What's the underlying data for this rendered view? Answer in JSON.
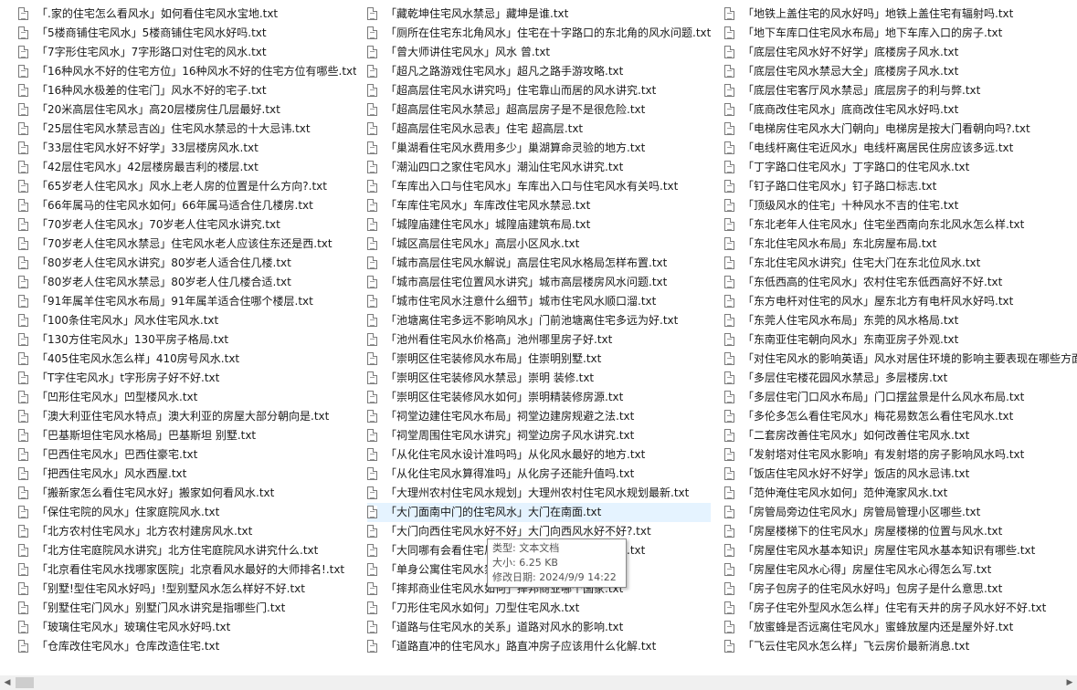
{
  "columns": [
    [
      "「.家的住宅怎么看风水」如何看住宅风水宝地.txt",
      "「5楼商铺住宅风水」5楼商铺住宅风水好吗.txt",
      "「7字形住宅风水」7字形路口对住宅的风水.txt",
      "「16种风水不好的住宅方位」16种风水不好的住宅方位有哪些.txt",
      "「16种风水极差的住宅门」风水不好的宅子.txt",
      "「20米高层住宅风水」高20层楼房住几层最好.txt",
      "「25层住宅风水禁忌吉凶」住宅风水禁忌的十大忌讳.txt",
      "「33层住宅风水好不好学」33层楼房风水.txt",
      "「42层住宅风水」42层楼房最吉利的楼层.txt",
      "「65岁老人住宅风水」风水上老人房的位置是什么方向?.txt",
      "「66年属马的住宅风水如何」66年属马适合住几楼房.txt",
      "「70岁老人住宅风水」70岁老人住宅风水讲究.txt",
      "「70岁老人住宅风水禁忌」住宅风水老人应该住东还是西.txt",
      "「80岁老人住宅风水讲究」80岁老人适合住几楼.txt",
      "「80岁老人住宅风水禁忌」80岁老人住几楼合适.txt",
      "「91年属羊住宅风水布局」91年属羊适合住哪个楼层.txt",
      "「100条住宅风水」风水住宅风水.txt",
      "「130方住宅风水」130平房子格局.txt",
      "「405住宅风水怎么样」410房号风水.txt",
      "「T字住宅风水」t字形房子好不好.txt",
      "「凹形住宅风水」凹型楼风水.txt",
      "「澳大利亚住宅风水特点」澳大利亚的房屋大部分朝向是.txt",
      "「巴基斯坦住宅风水格局」巴基斯坦 别墅.txt",
      "「巴西住宅风水」巴西住豪宅.txt",
      "「把西住宅风水」风水西屋.txt",
      "「搬新家怎么看住宅风水好」搬家如何看风水.txt",
      "「保住宅院的风水」住家庭院风水.txt",
      "「北方农村住宅风水」北方农村建房风水.txt",
      "「北方住宅庭院风水讲究」北方住宅庭院风水讲究什么.txt",
      "「北京看住宅风水找哪家医院」北京看风水最好的大师排名!.txt",
      "「别墅!型住宅风水好吗」!型别墅风水怎么样好不好.txt",
      "「别墅住宅门风水」别墅门风水讲究是指哪些门.txt",
      "「玻璃住宅风水」玻璃住宅风水好吗.txt",
      "「仓库改住宅风水」仓库改造住宅.txt"
    ],
    [
      "「藏乾坤住宅风水禁忌」藏坤是谁.txt",
      "「厕所在住宅东北角风水」住宅在十字路口的东北角的风水问题.txt",
      "「曾大师讲住宅风水」风水 曾.txt",
      "「超凡之路游戏住宅风水」超凡之路手游攻略.txt",
      "「超高层住宅风水讲究吗」住宅靠山而居的风水讲究.txt",
      "「超高层住宅风水禁忌」超高层房子是不是很危险.txt",
      "「超高层住宅风水忌表」住宅 超高层.txt",
      "「巢湖看住宅风水费用多少」巢湖算命灵验的地方.txt",
      "「潮汕四口之家住宅风水」潮汕住宅风水讲究.txt",
      "「车库出入口与住宅风水」车库出入口与住宅风水有关吗.txt",
      "「车库住宅风水」车库改住宅风水禁忌.txt",
      "「城隍庙建住宅风水」城隍庙建筑布局.txt",
      "「城区高层住宅风水」高层小区风水.txt",
      "「城市高层住宅风水解说」高层住宅风水格局怎样布置.txt",
      "「城市高层住宅位置风水讲究」城市高层楼房风水问题.txt",
      "「城市住宅风水注意什么细节」城市住宅风水顺口溜.txt",
      "「池塘离住宅多远不影响风水」门前池塘离住宅多远为好.txt",
      "「池州看住宅风水价格高」池州哪里房子好.txt",
      "「崇明区住宅装修风水布局」住崇明别墅.txt",
      "「崇明区住宅装修风水禁忌」崇明 装修.txt",
      "「崇明区住宅装修风水如何」崇明精装修房源.txt",
      "「祠堂边建住宅风水布局」祠堂边建房规避之法.txt",
      "「祠堂周围住宅风水讲究」祠堂边房子风水讲究.txt",
      "「从化住宅风水设计准吗吗」从化风水最好的地方.txt",
      "「从化住宅风水算得准吗」从化房子还能升值吗.txt",
      "「大理州农村住宅风水规划」大理州农村住宅风水规划最新.txt",
      "「大门面南中门的住宅风水」大门在南面.txt",
      "「大门向西住宅风水好不好」大门向西风水好不好?.txt",
      "「大同哪有会看住宅风水的人」大同会看风水的人.txt",
      "「单身公寓住宅风水禁忌大全」单身公寓风水.txt",
      "「摔邦商业住宅风水如何」摔邦商业哪个国家.txt",
      "「刀形住宅风水如何」刀型住宅风水.txt",
      "「道路与住宅风水的关系」道路对风水的影响.txt",
      "「道路直冲的住宅风水」路直冲房子应该用什么化解.txt"
    ],
    [
      "「地铁上盖住宅的风水好吗」地铁上盖住宅有辐射吗.txt",
      "「地下车库口住宅风水布局」地下车库入口的房子.txt",
      "「底层住宅风水好不好学」底楼房子风水.txt",
      "「底层住宅风水禁忌大全」底楼房子风水.txt",
      "「底层住宅客厅风水禁忌」底层房子的利与弊.txt",
      "「底商改住宅风水」底商改住宅风水好吗.txt",
      "「电梯房住宅风水大门朝向」电梯房是按大门看朝向吗?.txt",
      "「电线杆离住宅近风水」电线杆离居民住房应该多远.txt",
      "「丁字路口住宅风水」丁字路口的住宅风水.txt",
      "「钉子路口住宅风水」钉子路口标志.txt",
      "「顶级风水的住宅」十种风水不吉的住宅.txt",
      "「东北老年人住宅风水」住宅坐西南向东北风水怎么样.txt",
      "「东北住宅风水布局」东北房屋布局.txt",
      "「东北住宅风水讲究」住宅大门在东北位风水.txt",
      "「东低西高的住宅风水」农村住宅东低西高好不好.txt",
      "「东方电杆对住宅的风水」屋东北方有电杆风水好吗.txt",
      "「东莞人住宅风水布局」东莞的风水格局.txt",
      "「东南亚住宅朝向风水」东南亚房子外观.txt",
      "「对住宅风水的影响英语」风水对居住环境的影响主要表现在哪些方面.txt",
      "「多层住宅楼花园风水禁忌」多层楼房.txt",
      "「多层住宅门口风水布局」门口摆盆景是什么风水布局.txt",
      "「多伦多怎么看住宅风水」梅花易数怎么看住宅风水.txt",
      "「二套房改善住宅风水」如何改善住宅风水.txt",
      "「发射塔对住宅风水影响」有发射塔的房子影响风水吗.txt",
      "「饭店住宅风水好不好学」饭店的风水忌讳.txt",
      "「范仲淹住宅风水如何」范仲淹家风水.txt",
      "「房管局旁边住宅风水」房管局管理小区哪些.txt",
      "「房屋楼梯下的住宅风水」房屋楼梯的位置与风水.txt",
      "「房屋住宅风水基本知识」房屋住宅风水基本知识有哪些.txt",
      "「房屋住宅风水心得」房屋住宅风水心得怎么写.txt",
      "「房子包房子的住宅风水好吗」包房子是什么意思.txt",
      "「房子住宅外型风水怎么样」住宅有天井的房子风水好不好.txt",
      "「放蜜蜂是否远离住宅风水」蜜蜂放屋内还是屋外好.txt",
      "「飞云住宅风水怎么样」飞云房价最新消息.txt"
    ]
  ],
  "tooltip": {
    "type": "类型: 文本文档",
    "size": "大小: 6.25 KB",
    "modified": "修改日期: 2024/9/9 14:22"
  },
  "scrollbar": {
    "left_arrow": "◀",
    "right_arrow": "▶"
  },
  "selection_color": "#e5f3ff"
}
